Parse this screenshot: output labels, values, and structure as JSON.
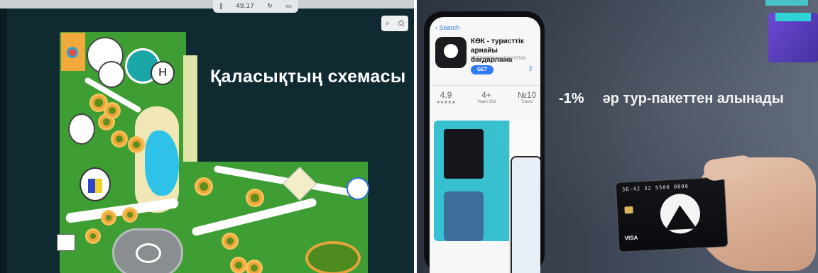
{
  "left_photo": {
    "title": "Қаласықтың схемасы",
    "toolbar_zoom": "49.17",
    "bubble_h": "H"
  },
  "right_photo": {
    "back_link": "Search",
    "app_title": "КӨК - туристтік арнайы бағдарлама",
    "developer": "KT TOURISM KAZAKHSTAN",
    "get_label": "GET",
    "stats": [
      {
        "value": "4.9",
        "sub": "★★★★★"
      },
      {
        "value": "4+",
        "sub": "Years Old"
      },
      {
        "value": "№10",
        "sub": "Travel"
      }
    ],
    "promo_percent": "-1%",
    "promo_text": "әр тур-пакеттен алынады",
    "card_number": "ЗБ-42 32 5500 0000",
    "card_brand": "VISA"
  },
  "colors": {
    "slide_bg": "#0f2a30",
    "park_green": "#3e9e33",
    "pool_blue": "#2ec2e8",
    "ios_blue": "#2f7bf6",
    "wall": "#3a4250"
  }
}
